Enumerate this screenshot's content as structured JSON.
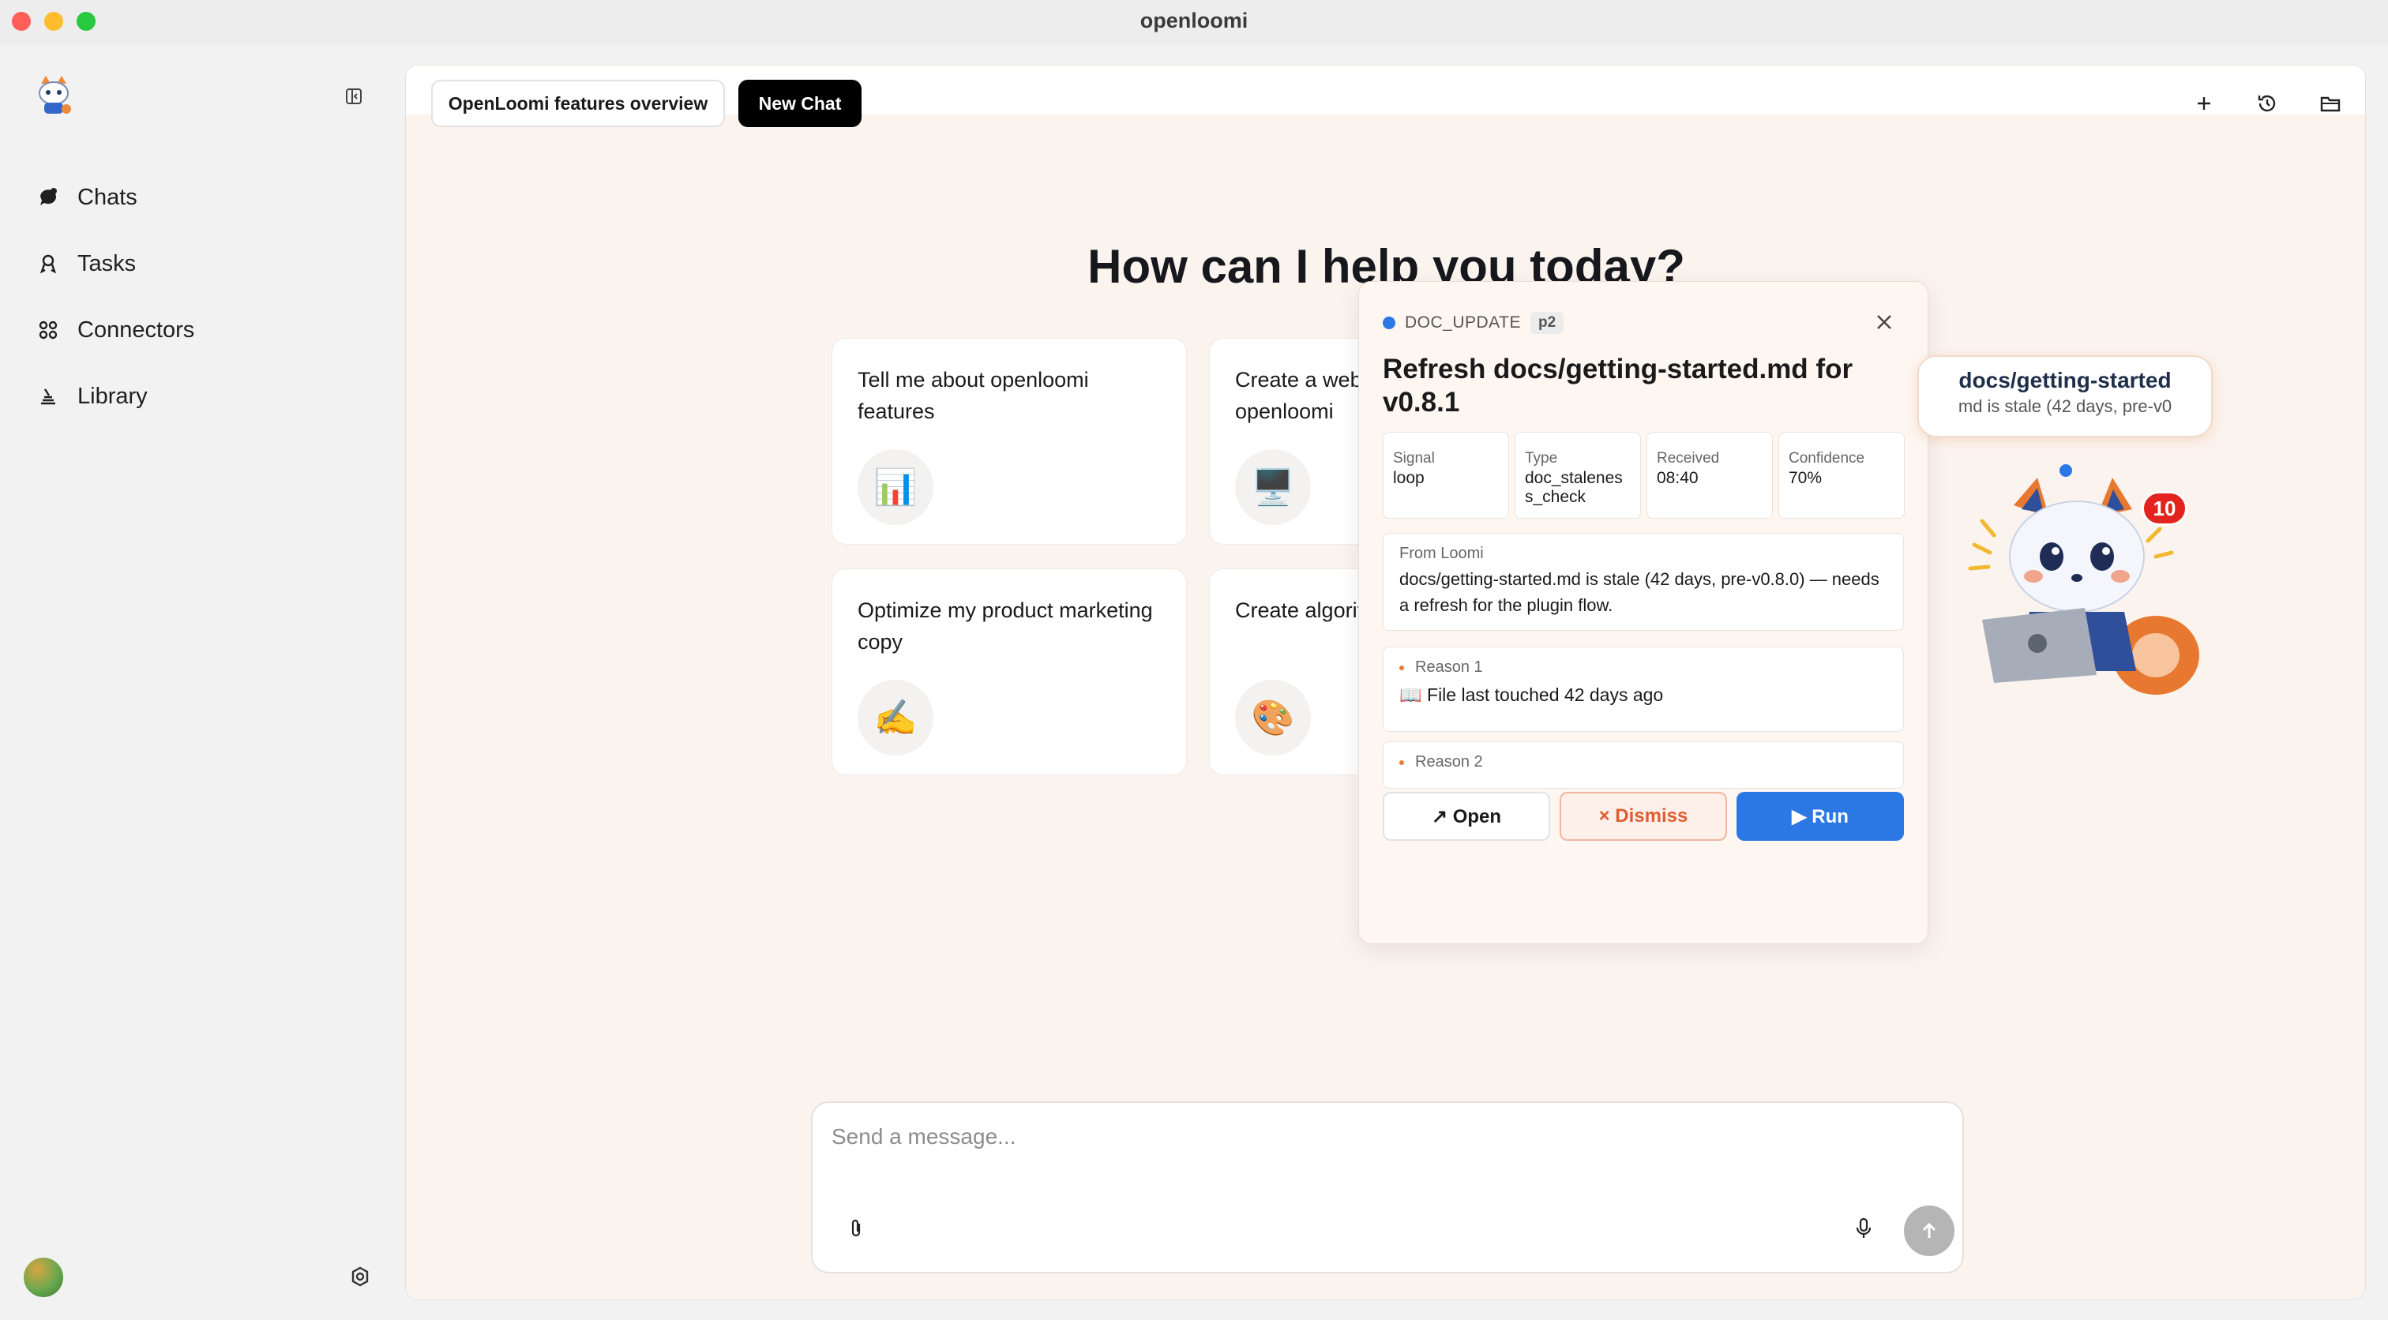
{
  "window": {
    "title": "openloomi"
  },
  "sidebar": {
    "items": [
      {
        "label": "Chats",
        "icon": "chats-icon"
      },
      {
        "label": "Tasks",
        "icon": "tasks-icon"
      },
      {
        "label": "Connectors",
        "icon": "connectors-icon"
      },
      {
        "label": "Library",
        "icon": "library-icon"
      }
    ]
  },
  "tabs": {
    "overview_label": "OpenLoomi features overview",
    "new_chat_label": "New Chat"
  },
  "main": {
    "heading": "How can I help you today?",
    "cards": [
      {
        "title": "Tell me about openloomi features",
        "icon": "📊"
      },
      {
        "title": "Create a webs openloomi",
        "icon": "🖥️"
      },
      {
        "title": "Optimize my product marketing copy",
        "icon": "✍️"
      },
      {
        "title": "Create algorit",
        "icon": "🎨"
      }
    ]
  },
  "composer": {
    "placeholder": "Send a message..."
  },
  "popup": {
    "kind": "DOC_UPDATE",
    "priority": "p2",
    "title": "Refresh docs/getting-started.md for v0.8.1",
    "meta": [
      {
        "label": "Signal",
        "value": "loop"
      },
      {
        "label": "Type",
        "value": "doc_staleness_check"
      },
      {
        "label": "Received",
        "value": "08:40"
      },
      {
        "label": "Confidence",
        "value": "70%"
      }
    ],
    "from_label": "From Loomi",
    "from_text": "docs/getting-started.md is stale (42 days, pre-v0.8.0) — needs a refresh for the plugin flow.",
    "reasons": [
      {
        "label": "Reason 1",
        "text": "📖 File last touched 42 days ago"
      },
      {
        "label": "Reason 2",
        "text": ""
      }
    ],
    "buttons": {
      "open": "↗ Open",
      "dismiss": "× Dismiss",
      "run": "▶ Run"
    }
  },
  "mascot": {
    "speech_title": "docs/getting-started",
    "speech_sub": "md is stale (42 days, pre-v0",
    "badge_count": "10"
  },
  "colors": {
    "accent": "#2b78e4",
    "badge": "#e3231d",
    "dismiss": "#e05d32",
    "panel_bg": "#fbf3ee"
  }
}
